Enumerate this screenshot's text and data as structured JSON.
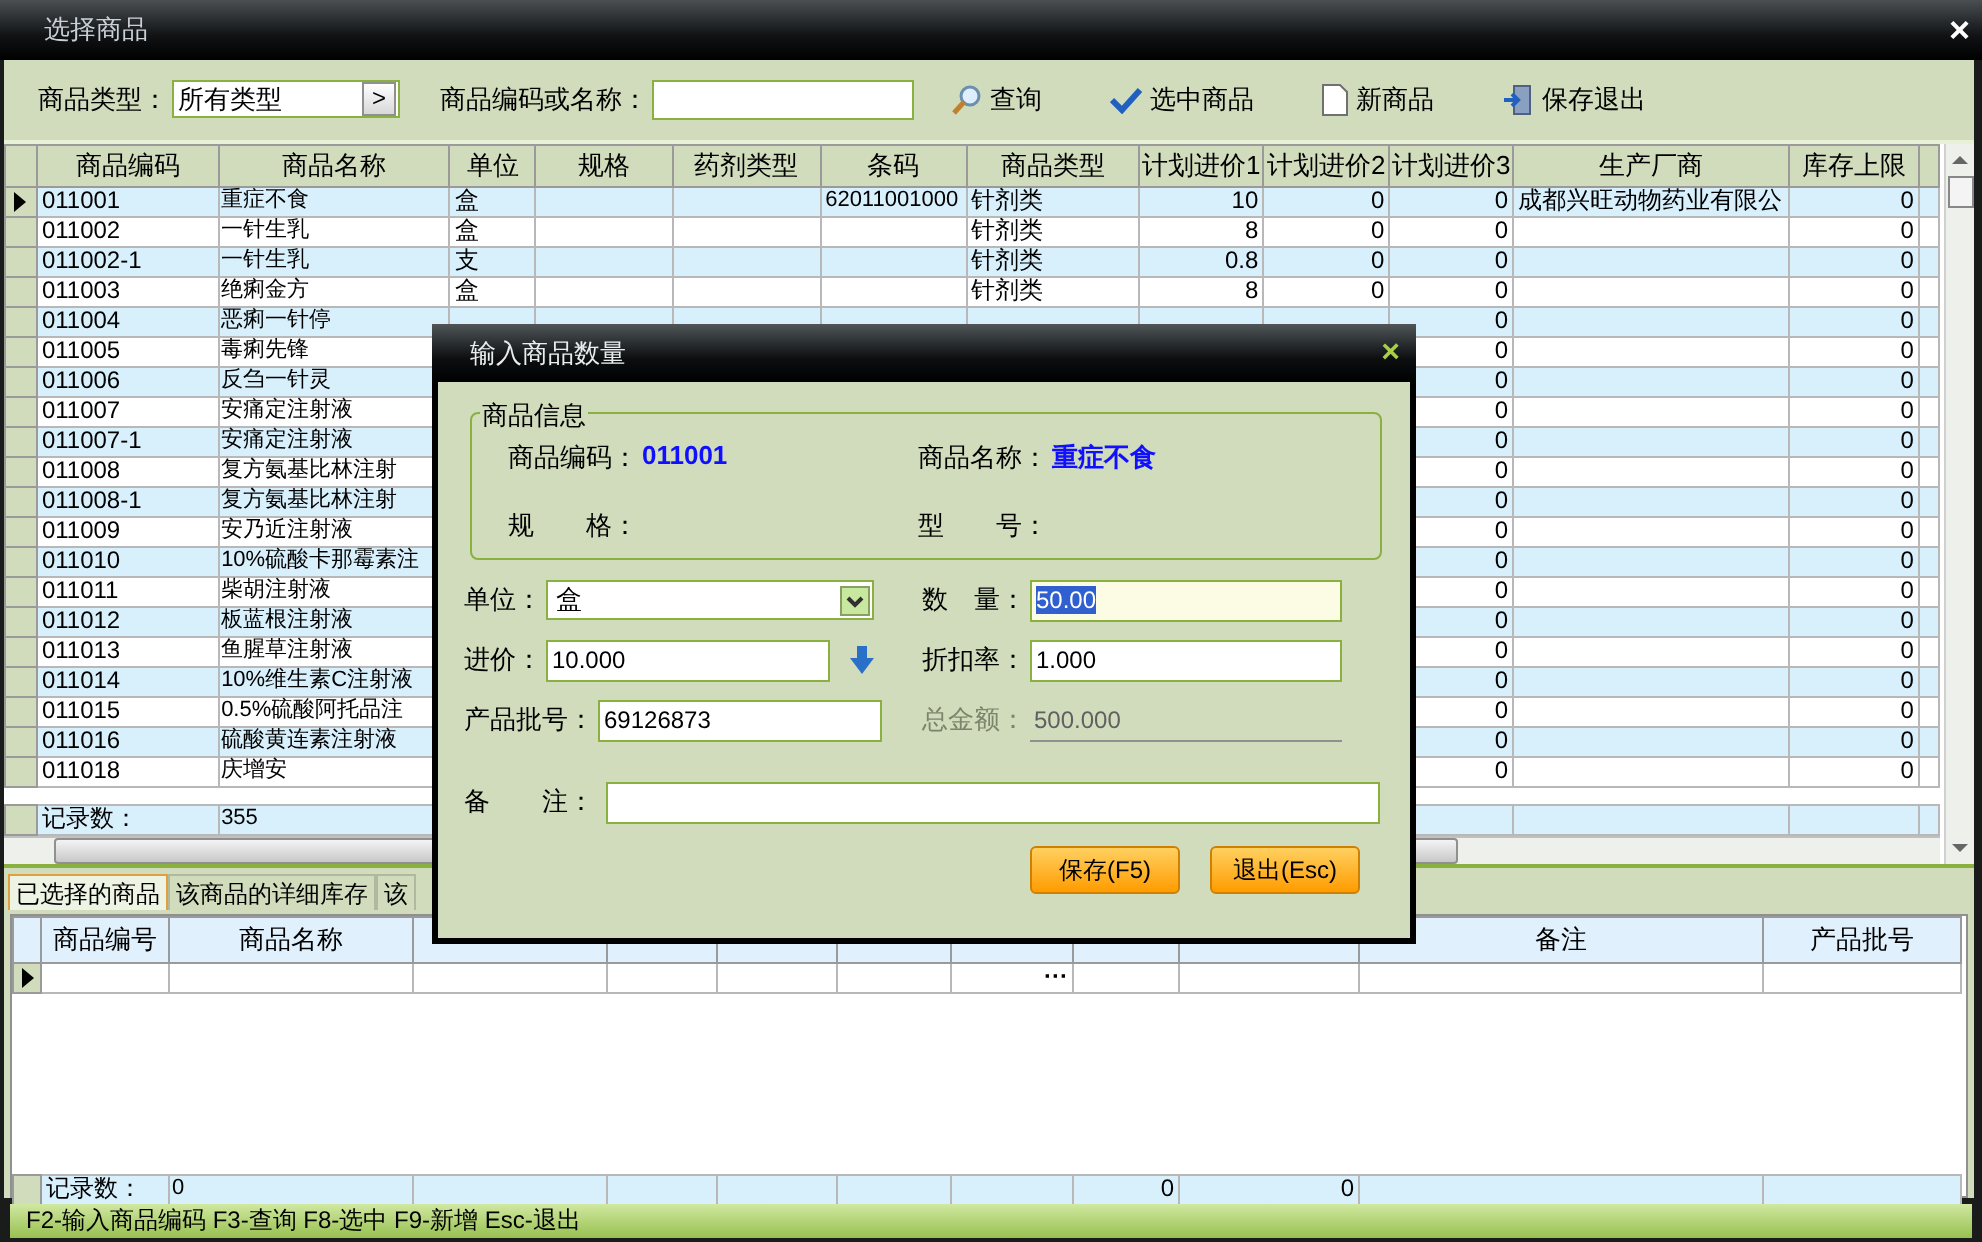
{
  "window": {
    "title": "选择商品",
    "close": "×"
  },
  "toolbar": {
    "type_label": "商品类型：",
    "type_value": "所有类型",
    "type_button": ">",
    "search_label": "商品编码或名称：",
    "buttons": [
      {
        "label": "查询",
        "kind": "search"
      },
      {
        "label": "选中商品",
        "kind": "check"
      },
      {
        "label": "新商品",
        "kind": "new"
      },
      {
        "label": "保存退出",
        "kind": "exit"
      }
    ]
  },
  "table": {
    "columns": [
      "商品编码",
      "商品名称",
      "单位",
      "规格",
      "药剂类型",
      "条码",
      "商品类型",
      "计划进价1",
      "计划进价2",
      "计划进价3",
      "生产厂商",
      "库存上限"
    ],
    "rows": [
      {
        "selected": true,
        "cells": [
          "011001",
          "重症不食",
          "盒",
          null,
          null,
          "62011001000",
          "针剂类",
          "10",
          "0",
          "0",
          "成都兴旺动物药业有限公",
          "0"
        ]
      },
      {
        "selected": false,
        "cells": [
          "011002",
          "一针生乳",
          "盒",
          null,
          null,
          null,
          "针剂类",
          "8",
          "0",
          "0",
          null,
          "0"
        ]
      },
      {
        "selected": false,
        "cells": [
          "011002-1",
          "一针生乳",
          "支",
          null,
          null,
          null,
          "针剂类",
          "0.8",
          "0",
          "0",
          null,
          "0"
        ]
      },
      {
        "selected": false,
        "cells": [
          "011003",
          "绝痢金方",
          "盒",
          null,
          null,
          null,
          "针剂类",
          "8",
          "0",
          "0",
          null,
          "0"
        ]
      },
      {
        "selected": false,
        "cells": [
          "011004",
          "恶痢一针停",
          null,
          null,
          null,
          null,
          null,
          null,
          null,
          "0",
          null,
          "0"
        ]
      },
      {
        "selected": false,
        "cells": [
          "011005",
          "毒痢先锋",
          null,
          null,
          null,
          null,
          null,
          null,
          null,
          "0",
          null,
          "0"
        ]
      },
      {
        "selected": false,
        "cells": [
          "011006",
          "反刍一针灵",
          null,
          null,
          null,
          null,
          null,
          null,
          null,
          "0",
          null,
          "0"
        ]
      },
      {
        "selected": false,
        "cells": [
          "011007",
          "安痛定注射液",
          null,
          null,
          null,
          null,
          null,
          null,
          null,
          "0",
          null,
          "0"
        ]
      },
      {
        "selected": false,
        "cells": [
          "011007-1",
          "安痛定注射液",
          null,
          null,
          null,
          null,
          null,
          null,
          null,
          "0",
          null,
          "0"
        ]
      },
      {
        "selected": false,
        "cells": [
          "011008",
          "复方氨基比林注射",
          null,
          null,
          null,
          null,
          null,
          null,
          null,
          "0",
          null,
          "0"
        ]
      },
      {
        "selected": false,
        "cells": [
          "011008-1",
          "复方氨基比林注射",
          null,
          null,
          null,
          null,
          null,
          null,
          null,
          "0",
          null,
          "0"
        ]
      },
      {
        "selected": false,
        "cells": [
          "011009",
          "安乃近注射液",
          null,
          null,
          null,
          null,
          null,
          null,
          null,
          "0",
          null,
          "0"
        ]
      },
      {
        "selected": false,
        "cells": [
          "011010",
          "10%硫酸卡那霉素注",
          null,
          null,
          null,
          null,
          null,
          null,
          null,
          "0",
          null,
          "0"
        ]
      },
      {
        "selected": false,
        "cells": [
          "011011",
          "柴胡注射液",
          null,
          null,
          null,
          null,
          null,
          null,
          null,
          "0",
          null,
          "0"
        ]
      },
      {
        "selected": false,
        "cells": [
          "011012",
          "板蓝根注射液",
          null,
          null,
          null,
          null,
          null,
          null,
          null,
          "0",
          null,
          "0"
        ]
      },
      {
        "selected": false,
        "cells": [
          "011013",
          "鱼腥草注射液",
          null,
          null,
          null,
          null,
          null,
          null,
          null,
          "0",
          null,
          "0"
        ]
      },
      {
        "selected": false,
        "cells": [
          "011014",
          "10%维生素C注射液",
          null,
          null,
          null,
          null,
          null,
          null,
          null,
          "0",
          null,
          "0"
        ]
      },
      {
        "selected": false,
        "cells": [
          "011015",
          "0.5%硫酸阿托品注",
          null,
          null,
          null,
          null,
          null,
          null,
          null,
          "0",
          null,
          "0"
        ]
      },
      {
        "selected": false,
        "cells": [
          "011016",
          "硫酸黄连素注射液",
          null,
          null,
          null,
          null,
          null,
          null,
          null,
          "0",
          null,
          "0"
        ]
      },
      {
        "selected": false,
        "cells": [
          "011018",
          "庆增安",
          null,
          null,
          null,
          null,
          null,
          null,
          null,
          "0",
          null,
          "0"
        ]
      }
    ],
    "footer": [
      "记录数：",
      "355"
    ]
  },
  "bottom_tabs": [
    {
      "label": "已选择的商品",
      "selected": true
    },
    {
      "label": "该商品的详细库存",
      "selected": false
    },
    {
      "label": "该",
      "selected": false
    }
  ],
  "detail_table": {
    "columns": [
      "商品编号",
      "商品名称",
      null,
      null,
      null,
      null,
      null,
      null,
      null,
      "备注",
      "产品批号"
    ],
    "rows": [
      {
        "selected": true,
        "cells": [
          null,
          null,
          null,
          null,
          null,
          null,
          "···",
          null,
          null,
          null,
          null
        ]
      }
    ],
    "footer": {
      "label": "记录数：",
      "count": "0",
      "totals": [
        "0",
        "0"
      ]
    }
  },
  "status_bar": "F2-输入商品编码 F3-查询 F8-选中 F9-新增 Esc-退出",
  "dialog": {
    "title": "输入商品数量",
    "close": "×",
    "group": {
      "title": "商品信息",
      "fields": [
        {
          "label": "商品编码：",
          "value": "011001"
        },
        {
          "label": "商品名称：",
          "value": "重症不食"
        },
        {
          "label": "规　　格："
        },
        {
          "label": "型　　号："
        }
      ]
    },
    "unit": {
      "label": "单位：",
      "value": "盒"
    },
    "quantity": {
      "label": "数　量：",
      "value": "50.00",
      "focused": true
    },
    "price": {
      "label": "进价：",
      "value": "10.000"
    },
    "discount": {
      "label": "折扣率：",
      "value": "1.000"
    },
    "batch": {
      "label": "产品批号：",
      "value": "69126873"
    },
    "total": {
      "label": "总金额：",
      "value": "500.000",
      "disabled": true
    },
    "note": {
      "label": "备　　注："
    },
    "buttons": [
      "保存(F5)",
      "退出(Esc)"
    ]
  }
}
